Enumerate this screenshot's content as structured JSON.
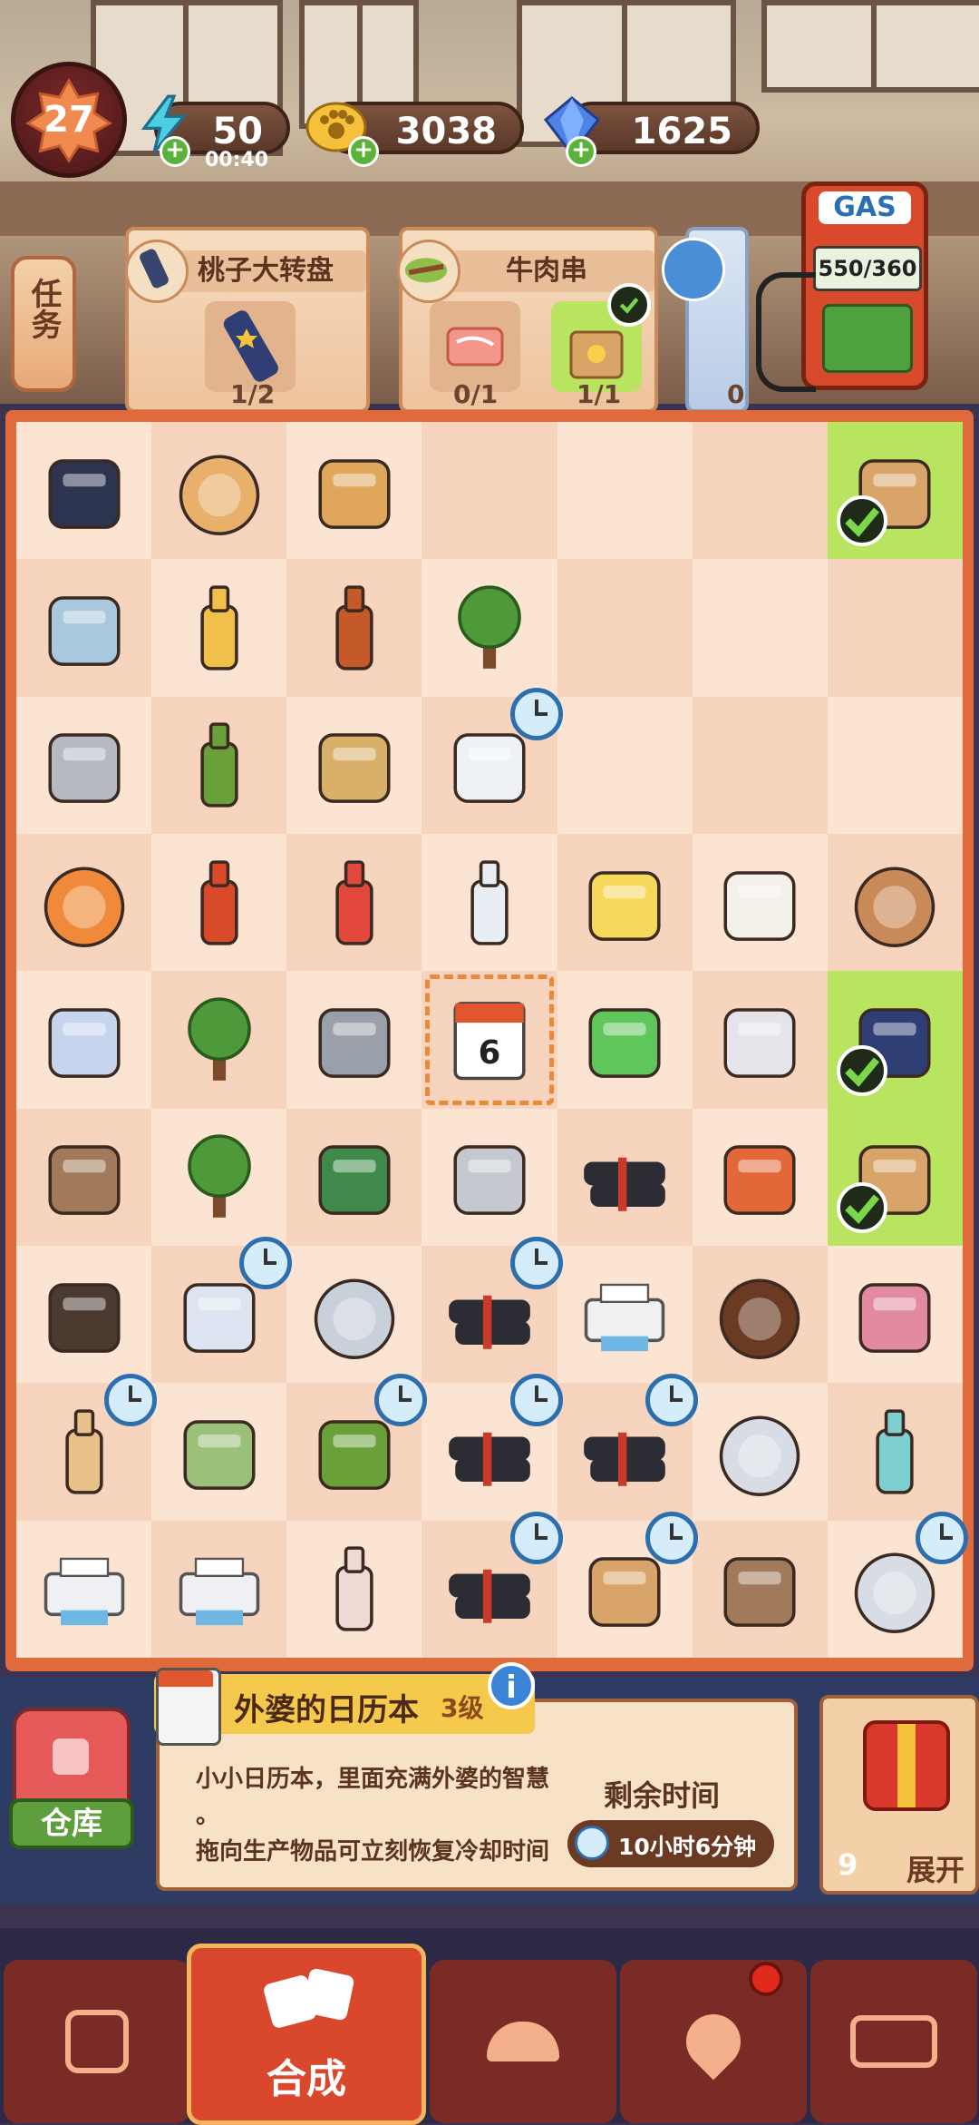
{
  "player": {
    "level": "27"
  },
  "resources": {
    "energy": {
      "value": "50",
      "timer": "00:40",
      "icon": "energy-lightning-icon"
    },
    "coins": {
      "value": "3038",
      "icon": "paw-coin-icon"
    },
    "gems": {
      "value": "1625",
      "icon": "diamond-icon"
    }
  },
  "gas": {
    "label": "GAS",
    "value": "550/360"
  },
  "tasks": {
    "tab_label": "任务",
    "cards": [
      {
        "title": "桃子大转盘",
        "count": "1/2"
      },
      {
        "title": "牛肉串",
        "counts": [
          "0/1",
          "1/1"
        ]
      },
      {
        "title": "",
        "count": "0"
      }
    ]
  },
  "board": {
    "rows": [
      [
        "chef-hat",
        "roast-chicken-plate",
        "wooden-mallet",
        "",
        "",
        "",
        "lunch-box-done"
      ],
      [
        "glass-cabinet",
        "sauce-bottle-small",
        "soy-sauce-bottle",
        "broccoli",
        "",
        "",
        ""
      ],
      [
        "safe-box",
        "sauce-bottle-green",
        "herb-cutting-board",
        "salt-shaker",
        "",
        "",
        ""
      ],
      [
        "pizza",
        "hot-sauce-bottle",
        "ketchup-bottle",
        "milk-bottles",
        "butter-pack",
        "flour-bag",
        "meatball"
      ],
      [
        "notepad",
        "bonsai-tree",
        "hammer",
        "calendar",
        "chewing-gum",
        "battery-pack",
        "telescope-done"
      ],
      [
        "clamp",
        "big-tree",
        "hand-truck",
        "safe-open",
        "sugarcane",
        "skewer-cards",
        "lunch-box-done"
      ],
      [
        "wall-shelf",
        "notebook",
        "stopwatch",
        "sugarcane-bundle",
        "printer-small",
        "chocolate-plate",
        "razor"
      ],
      [
        "bottle-shelf",
        "rice-cooker",
        "scooter",
        "sugarcane-big",
        "sugarcane-pile",
        "steel-pot",
        "jar-teal"
      ],
      [
        "printer-a",
        "printer-b",
        "sugar-jar",
        "sugarcane-tied",
        "delivery-cart",
        "clamp-pair",
        "hot-pot"
      ]
    ],
    "timers": [
      "2-3",
      "6-1",
      "6-3",
      "7-0",
      "7-2",
      "7-3",
      "7-4",
      "8-3",
      "8-4",
      "8-6"
    ],
    "highlighted": [
      "0-6",
      "4-6",
      "5-6"
    ],
    "selected": "4-3",
    "checks": [
      "0-6",
      "4-6",
      "5-6"
    ]
  },
  "selected_item": {
    "name": "外婆的日历本",
    "level": "3级",
    "description_line1": "小小日历本，里面充满外婆的智慧",
    "description_line2": "。",
    "description_line3": "拖向生产物品可立刻恢复冷却时间",
    "remaining_label": "剩余时间",
    "remaining_time": "10小时6分钟"
  },
  "warehouse": {
    "label": "仓库"
  },
  "expand": {
    "count": "9",
    "label": "展开"
  },
  "nav": {
    "active_label": "合成"
  },
  "colors": {
    "accent": "#d9472c",
    "board": "#fbe4d2",
    "frame": "#e06a3c",
    "done": "#b8e45f"
  }
}
